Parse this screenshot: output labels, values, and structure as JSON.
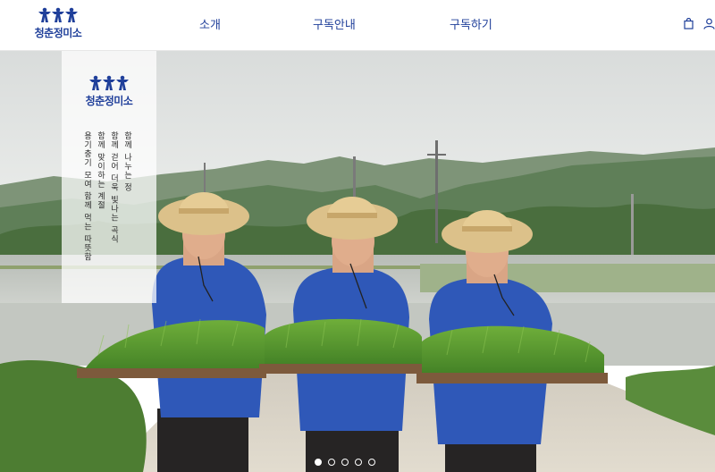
{
  "brand": {
    "name": "청춘정미소"
  },
  "nav": {
    "about": "소개",
    "guide": "구독안내",
    "subscribe": "구독하기"
  },
  "icons": {
    "cart": "shopping-bag-icon",
    "user": "user-icon"
  },
  "hero": {
    "panel_brand": "청춘정미소",
    "poem_lines": [
      "함께 나누는 정",
      "함께 걷어 더욱 빛나는 곡식",
      "함께 맞이하는 계절",
      "용기충기 모여 함께 먹는 따뜻함"
    ],
    "slides": {
      "count": 5,
      "active": 1
    }
  },
  "colors": {
    "brand_blue": "#1f3f9a",
    "shirt_blue": "#2f58b8"
  }
}
